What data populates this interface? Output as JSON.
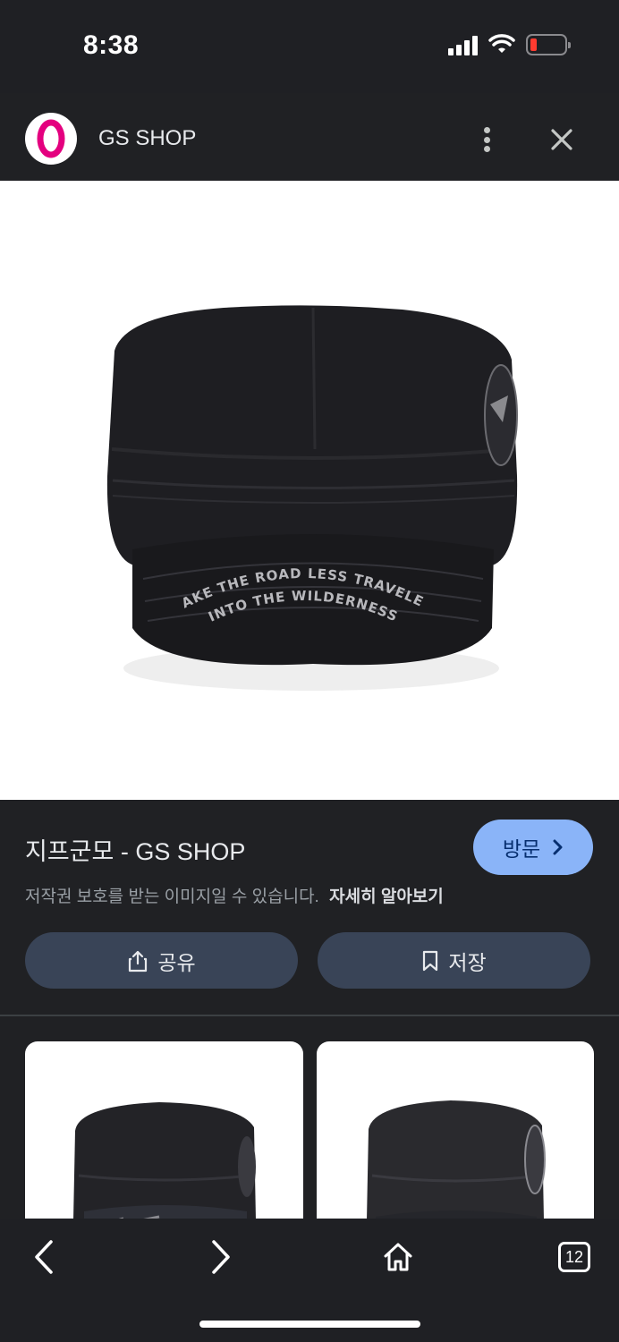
{
  "status_bar": {
    "time": "8:38",
    "battery_color": "#ff3b30"
  },
  "header": {
    "title": "GS SHOP",
    "logo_color": "#e4007f",
    "more_icon": "more-vert-icon",
    "close_icon": "close-icon"
  },
  "product": {
    "title": "지프군모 - GS SHOP",
    "visit_label": "방문",
    "copyright_text": "저작권 보호를 받는 이미지일 수 있습니다.",
    "learn_more": "자세히 알아보기",
    "share_label": "공유",
    "save_label": "저장",
    "cap_text_line1": "TAKE THE ROAD LESS TRAVELED",
    "cap_text_line2": "INTO THE WILDERNESS"
  },
  "bottom_nav": {
    "tabs_count": "12"
  },
  "colors": {
    "accent": "#8ab4f8",
    "button_bg": "#394457",
    "panel_bg": "#202124"
  }
}
